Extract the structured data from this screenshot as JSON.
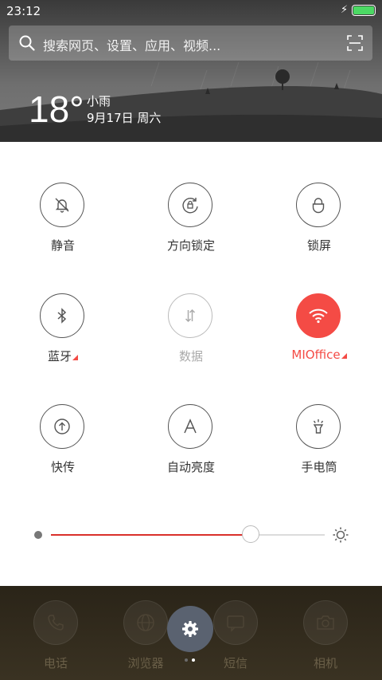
{
  "status": {
    "time": "23:12"
  },
  "search": {
    "placeholder": "搜索网页、设置、应用、视频..."
  },
  "weather": {
    "temperature": "18°",
    "condition": "小雨",
    "date": "9月17日 周六"
  },
  "toggles": [
    {
      "label": "静音",
      "icon": "bell-off-icon",
      "state": "off"
    },
    {
      "label": "方向锁定",
      "icon": "rotation-lock-icon",
      "state": "off"
    },
    {
      "label": "锁屏",
      "icon": "lock-icon",
      "state": "off"
    },
    {
      "label": "蓝牙",
      "icon": "bluetooth-icon",
      "state": "off",
      "has_more": true
    },
    {
      "label": "数据",
      "icon": "data-arrows-icon",
      "state": "disabled"
    },
    {
      "label": "MIOffice",
      "icon": "wifi-icon",
      "state": "on",
      "has_more": true
    },
    {
      "label": "快传",
      "icon": "quick-transfer-icon",
      "state": "off"
    },
    {
      "label": "自动亮度",
      "icon": "auto-brightness-icon",
      "state": "off"
    },
    {
      "label": "手电筒",
      "icon": "flashlight-icon",
      "state": "off"
    }
  ],
  "brightness": {
    "level_percent": 73
  },
  "dock": {
    "items": [
      {
        "label": "电话",
        "icon": "phone-icon"
      },
      {
        "label": "浏览器",
        "icon": "globe-icon"
      },
      {
        "label": "短信",
        "icon": "message-icon"
      },
      {
        "label": "相机",
        "icon": "camera-icon"
      }
    ]
  },
  "colors": {
    "accent": "#f44b45",
    "toggle_border": "#555555",
    "dock_bg": "#2a2418"
  }
}
